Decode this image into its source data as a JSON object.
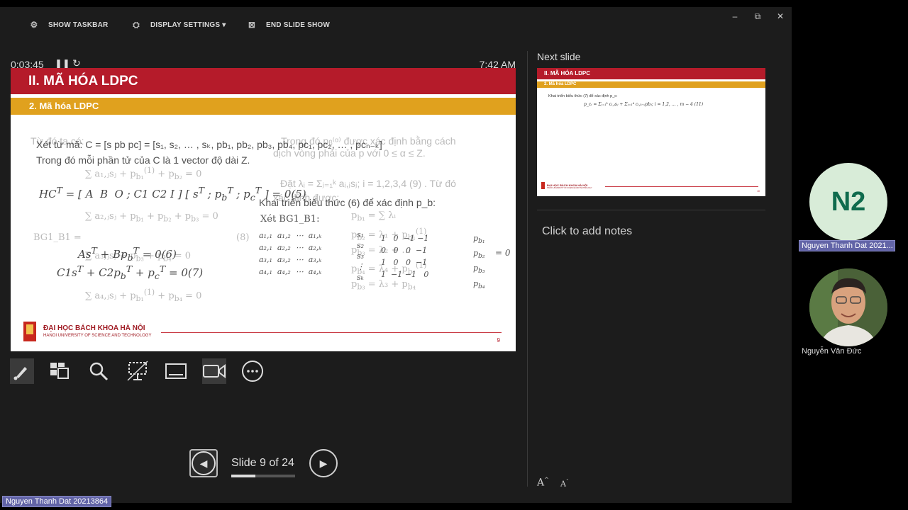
{
  "toolbar": {
    "show_taskbar": "SHOW TASKBAR",
    "display_settings": "DISPLAY SETTINGS ▾",
    "end_slide_show": "END SLIDE SHOW"
  },
  "window_controls": {
    "minimize": "–",
    "restore": "⧉",
    "close": "✕"
  },
  "timer": {
    "elapsed": "0:03:45",
    "clock": "7:42 AM"
  },
  "slide": {
    "title": "II. MÃ HÓA LDPC",
    "subtitle": "2. Mã hóa LDPC",
    "line1": "Xét từ mã: C = [s pb pc] = [s₁, s₂, … , sₖ, pb₁, pb₂, pb₃, pb₄, pc₁, pc₂, … , pcₙ₋ₖ]",
    "line2": "Trong đó mỗi phần tử của C là 1 vector độ dài Z.",
    "ghost1": "Từ đó ta có:",
    "ghost2": "Trong đó pᵦ⁽ᵅ⁾ được xác định bằng cách",
    "ghost3": "dịch vòng phải của p với 0 ≤ α ≤ Z.",
    "ghost4": "Đặt λᵢ = Σⱼ₌₁ᵏ aᵢ,ⱼsⱼ; i = 1,2,3,4 (9) . Từ đó",
    "ghost5": "xác định được:",
    "expand": "Khai triển biểu thức (6) để xác định p_b:",
    "xet": "Xét BG1_B1:",
    "eq5": "HCᵀ = [A B O ; C1 C2 I][sᵀ ; p_bᵀ ; p_cᵀ] = 0(5)",
    "eq6": "Asᵀ + Bp_bᵀ = 0(6)",
    "eq7": "C1sᵀ + C2p_bᵀ + p_cᵀ = 0(7)",
    "university_vn": "ĐẠI HỌC BÁCH KHOA HÀ NỘI",
    "university_en": "HANOI UNIVERSITY OF SCIENCE AND TECHNOLOGY",
    "page_number": "9"
  },
  "nav": {
    "counter": "Slide 9 of 24",
    "progress": 0.375
  },
  "next_slide": {
    "label": "Next slide",
    "title": "II. MÃ HÓA LDPC",
    "subtitle": "2. Mã hóa LDPC",
    "body": "Khai triển biểu thức (7) để xác định p_c:",
    "formula": "p_cᵢ = Σⱼ₌₁ᵏ cᵢ,ⱼsⱼ + Σⱼ₌₁⁴ cᵢ,ₖ₊ⱼpbⱼ;   i = 1,2, … , m − 4 (11)",
    "university_vn": "ĐẠI HỌC BÁCH KHOA HÀ NỘI",
    "university_en": "HANOI UNIVERSITY OF SCIENCE AND TECHNOLOGY",
    "page_number": "10"
  },
  "notes": {
    "placeholder": "Click to add notes"
  },
  "participants": [
    {
      "initials": "N2",
      "name": "Nguyen Thanh Dat 2021..."
    },
    {
      "name": "Nguyễn Văn Đức"
    }
  ],
  "self_name": "Nguyen Thanh Dat 20213864",
  "colors": {
    "slide_red": "#b51b2a",
    "slide_gold": "#e0a11e",
    "teams_purple": "#6264a7",
    "background": "#1c1c1c"
  },
  "icons": [
    "taskbar-icon",
    "display-settings-icon",
    "end-show-icon",
    "pen-icon",
    "slide-grid-icon",
    "zoom-icon",
    "pointer-screen-icon",
    "subtitles-icon",
    "camera-icon",
    "more-icon",
    "previous-icon",
    "next-icon"
  ]
}
